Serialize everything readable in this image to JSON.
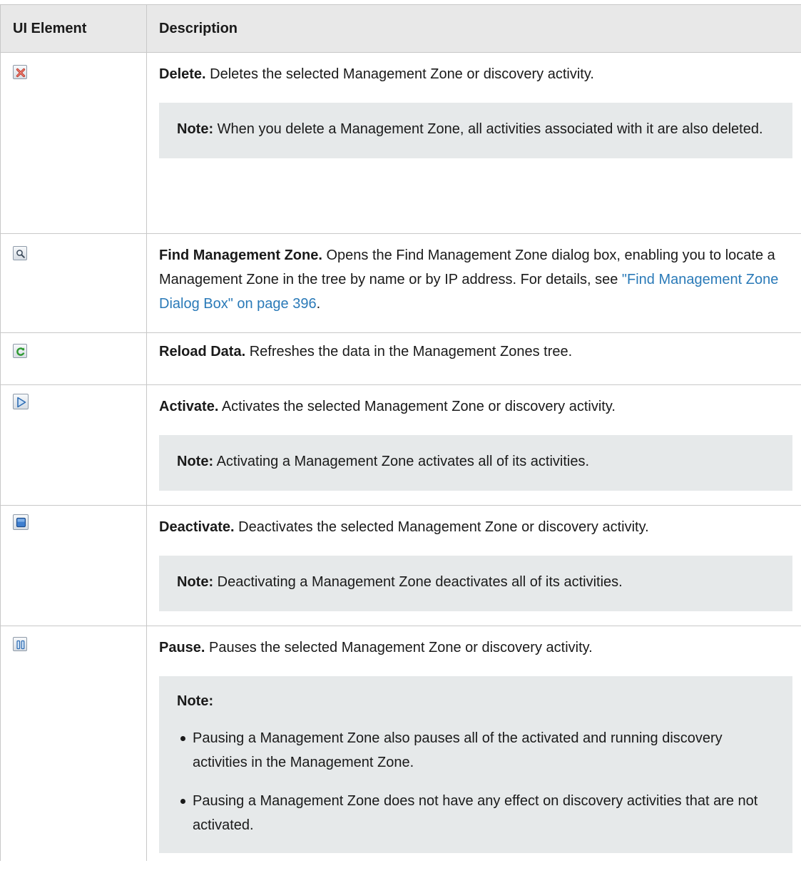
{
  "table": {
    "headers": {
      "ui_element": "UI Element",
      "description": "Description"
    },
    "rows": [
      {
        "icon": "delete-icon",
        "title": "Delete.",
        "text": " Deletes the selected Management Zone or discovery activity.",
        "note_label": "Note:",
        "note_text": " When you delete a Management Zone, all activities associated with it are also deleted."
      },
      {
        "icon": "find-icon",
        "title": "Find Management Zone.",
        "text": " Opens the Find Management Zone dialog box, enabling you to locate a Management Zone in the tree by name or by IP address. For details, see ",
        "link_text": "\"Find Management Zone Dialog Box\" on page 396",
        "text_end": "."
      },
      {
        "icon": "reload-icon",
        "title": "Reload Data.",
        "text": " Refreshes the data in the Management Zones tree."
      },
      {
        "icon": "activate-icon",
        "title": "Activate.",
        "text": " Activates the selected Management Zone or discovery activity.",
        "note_label": "Note:",
        "note_text": " Activating a Management Zone activates all of its activities."
      },
      {
        "icon": "deactivate-icon",
        "title": "Deactivate.",
        "text": " Deactivates the selected Management Zone or discovery activity.",
        "note_label": "Note:",
        "note_text": " Deactivating a Management Zone deactivates all of its activities."
      },
      {
        "icon": "pause-icon",
        "title": "Pause.",
        "text": " Pauses the selected Management Zone or discovery activity.",
        "note_label": "Note:",
        "bullets": [
          "Pausing a Management Zone also pauses all of the activated and running discovery activities in the Management Zone.",
          "Pausing a Management Zone does not have any effect on discovery activities that are not activated."
        ]
      }
    ]
  }
}
